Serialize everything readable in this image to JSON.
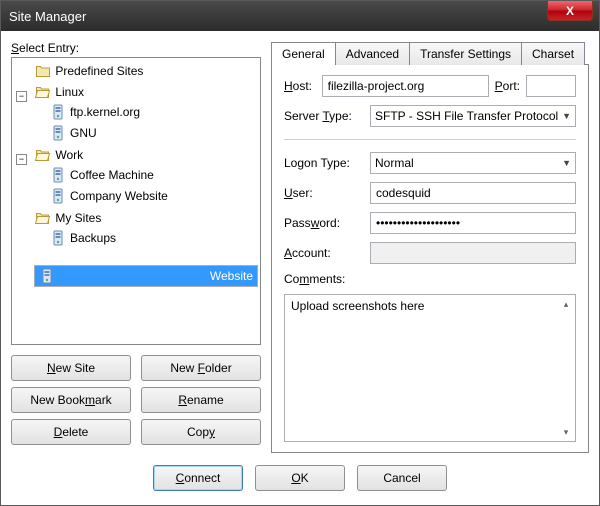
{
  "window": {
    "title": "Site Manager",
    "close": "X"
  },
  "left": {
    "select_label": "Select Entry:",
    "tree": {
      "predefined": "Predefined Sites",
      "linux": "Linux",
      "ftp_kernel": "ftp.kernel.org",
      "gnu": "GNU",
      "work": "Work",
      "coffee": "Coffee Machine",
      "company": "Company Website",
      "mysites": "My Sites",
      "backups": "Backups",
      "website": "Website"
    },
    "buttons": {
      "new_site": "New Site",
      "new_folder": "New Folder",
      "new_bookmark": "New Bookmark",
      "rename": "Rename",
      "delete": "Delete",
      "copy": "Copy"
    }
  },
  "tabs": {
    "general": "General",
    "advanced": "Advanced",
    "transfer": "Transfer Settings",
    "charset": "Charset"
  },
  "form": {
    "host_label": "Host:",
    "host_value": "filezilla-project.org",
    "port_label": "Port:",
    "port_value": "",
    "server_type_label": "Server Type:",
    "server_type_value": "SFTP - SSH File Transfer Protocol",
    "logon_type_label": "Logon Type:",
    "logon_type_value": "Normal",
    "user_label": "User:",
    "user_value": "codesquid",
    "password_label": "Password:",
    "password_value": "••••••••••••••••••••",
    "account_label": "Account:",
    "account_value": "",
    "comments_label": "Comments:",
    "comments_value": "Upload screenshots here"
  },
  "footer": {
    "connect": "Connect",
    "ok": "OK",
    "cancel": "Cancel"
  }
}
